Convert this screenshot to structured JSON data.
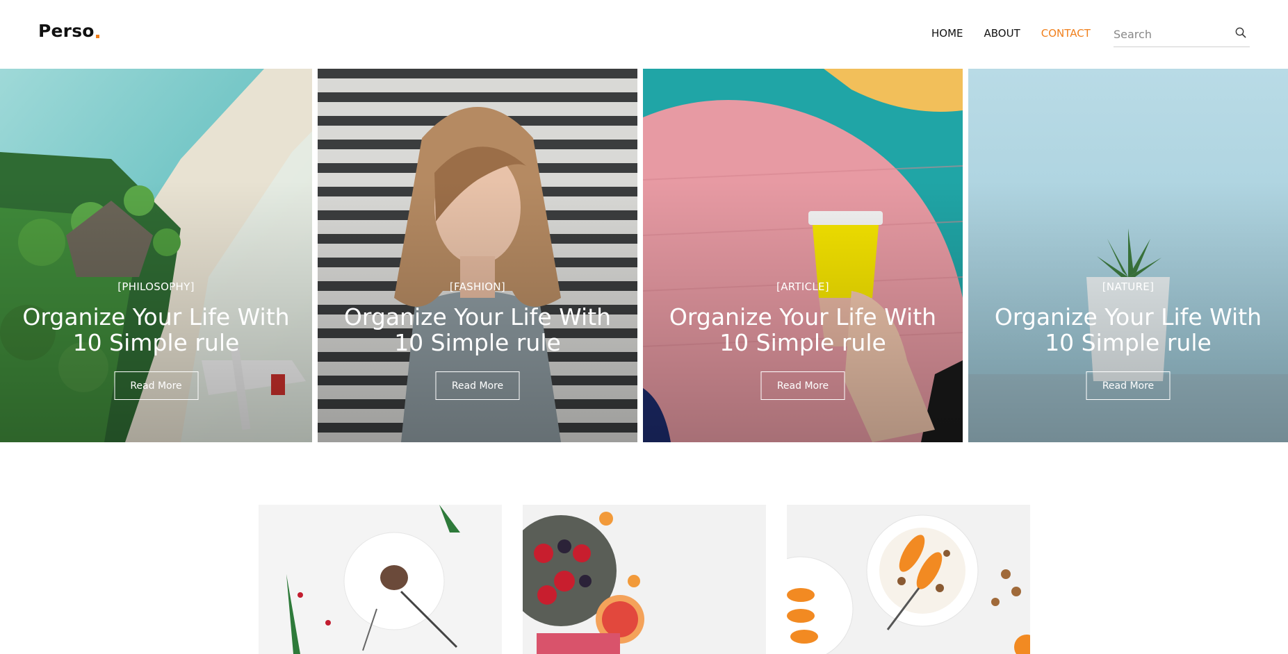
{
  "brand": {
    "name": "Perso"
  },
  "nav": {
    "items": [
      {
        "label": "HOME",
        "active": false
      },
      {
        "label": "ABOUT",
        "active": false
      },
      {
        "label": "CONTACT",
        "active": true
      }
    ]
  },
  "search": {
    "placeholder": "Search",
    "icon": "search-icon"
  },
  "colors": {
    "accent": "#f07f1b",
    "text": "#111111",
    "white": "#ffffff"
  },
  "hero_cards": [
    {
      "category": "[PHILOSOPHY]",
      "title": "Organize Your Life With 10 Simple rule",
      "button": "Read More",
      "image": "tropical-island-beach"
    },
    {
      "category": "[FASHION]",
      "title": "Organize Your Life With 10 Simple rule",
      "button": "Read More",
      "image": "woman-portrait-striped-wall"
    },
    {
      "category": "[ARTICLE]",
      "title": "Organize Your Life With 10 Simple rule",
      "button": "Read More",
      "image": "coffee-cup-colorful-wall"
    },
    {
      "category": "[NATURE]",
      "title": "Organize Your Life With 10 Simple rule",
      "button": "Read More",
      "image": "potted-succulent-blue"
    }
  ],
  "thumbnails": [
    {
      "image": "dessert-plate-pine"
    },
    {
      "image": "berries-bowl-grapefruit"
    },
    {
      "image": "granola-bowls-peaches"
    }
  ]
}
